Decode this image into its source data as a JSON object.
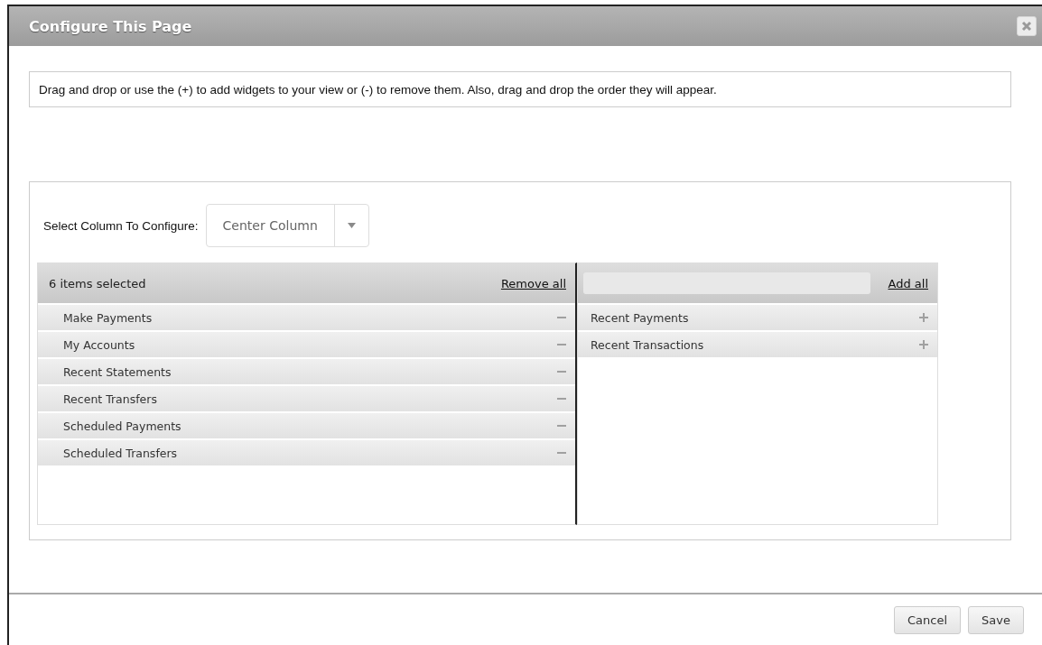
{
  "dialog": {
    "title": "Configure This Page"
  },
  "instructions": "Drag and drop or use the (+) to add widgets to your view or (-) to remove them. Also, drag and drop the order they will appear.",
  "column_select": {
    "label": "Select Column To Configure:",
    "value": "Center Column"
  },
  "selected_list": {
    "heading": "6 items selected",
    "action": "Remove all",
    "items": [
      {
        "label": "Make Payments"
      },
      {
        "label": "My Accounts"
      },
      {
        "label": "Recent Statements"
      },
      {
        "label": "Recent Transfers"
      },
      {
        "label": "Scheduled Payments"
      },
      {
        "label": "Scheduled Transfers"
      }
    ]
  },
  "available_list": {
    "action": "Add all",
    "items": [
      {
        "label": "Recent Payments"
      },
      {
        "label": "Recent Transactions"
      }
    ]
  },
  "buttons": [
    "Cancel",
    "Save"
  ]
}
